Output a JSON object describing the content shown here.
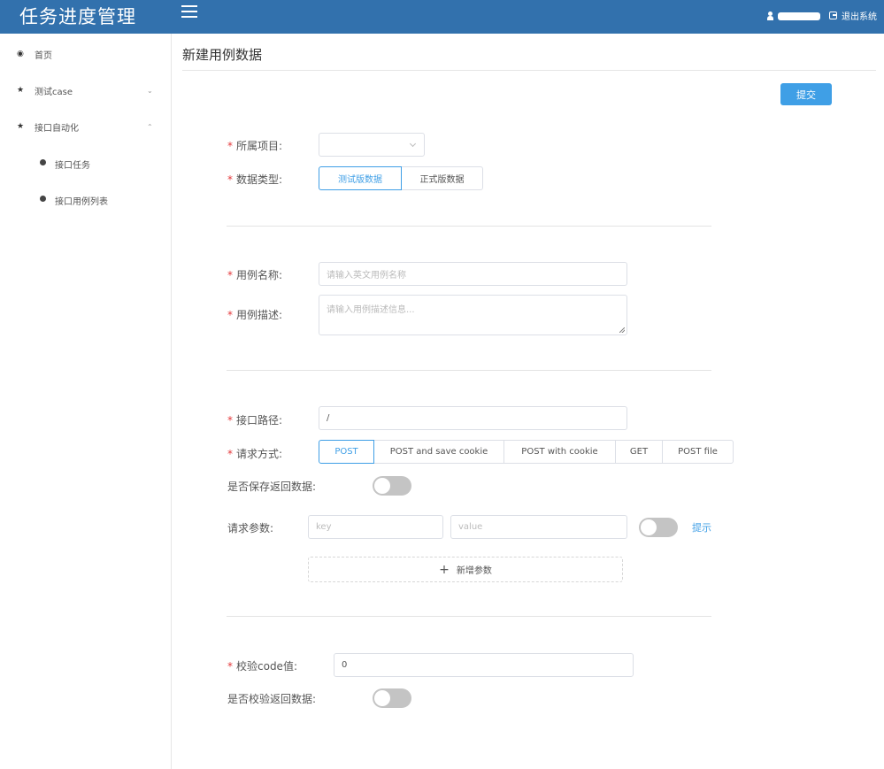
{
  "header": {
    "app_title": "任务进度管理",
    "logout_label": "退出系统"
  },
  "sidebar": {
    "items": [
      {
        "label": "首页",
        "icon": "dashboard-icon"
      },
      {
        "label": "测试case",
        "icon": "star-icon",
        "arrow": "chevron-down-icon"
      },
      {
        "label": "接口自动化",
        "icon": "star-icon",
        "arrow": "chevron-up-icon"
      }
    ],
    "sub_items": [
      {
        "label": "接口任务"
      },
      {
        "label": "接口用例列表"
      }
    ]
  },
  "main": {
    "title": "新建用例数据",
    "submit_label": "提交",
    "form": {
      "project_label": "所属项目:",
      "data_type_label": "数据类型:",
      "data_type_options": [
        "测试版数据",
        "正式版数据"
      ],
      "data_type_selected": "测试版数据",
      "case_name_label": "用例名称:",
      "case_name_placeholder": "请输入英文用例名称",
      "case_desc_label": "用例描述:",
      "case_desc_placeholder": "请输入用例描述信息...",
      "api_path_label": "接口路径:",
      "api_path_value": "/",
      "method_label": "请求方式:",
      "method_options": [
        "POST",
        "POST and save cookie",
        "POST with cookie",
        "GET",
        "POST file"
      ],
      "method_selected": "POST",
      "save_response_label": "是否保存返回数据:",
      "params_label": "请求参数:",
      "param_key_placeholder": "key",
      "param_value_placeholder": "value",
      "hint_link": "提示",
      "add_param_label": "新增参数",
      "check_code_label": "校验code值:",
      "check_code_value": "0",
      "check_response_label": "是否校验返回数据:"
    }
  },
  "colors": {
    "header_bg": "#3271ad",
    "accent": "#3f9fe6",
    "required": "#e4393c",
    "switch_off": "#c4c4c4"
  }
}
